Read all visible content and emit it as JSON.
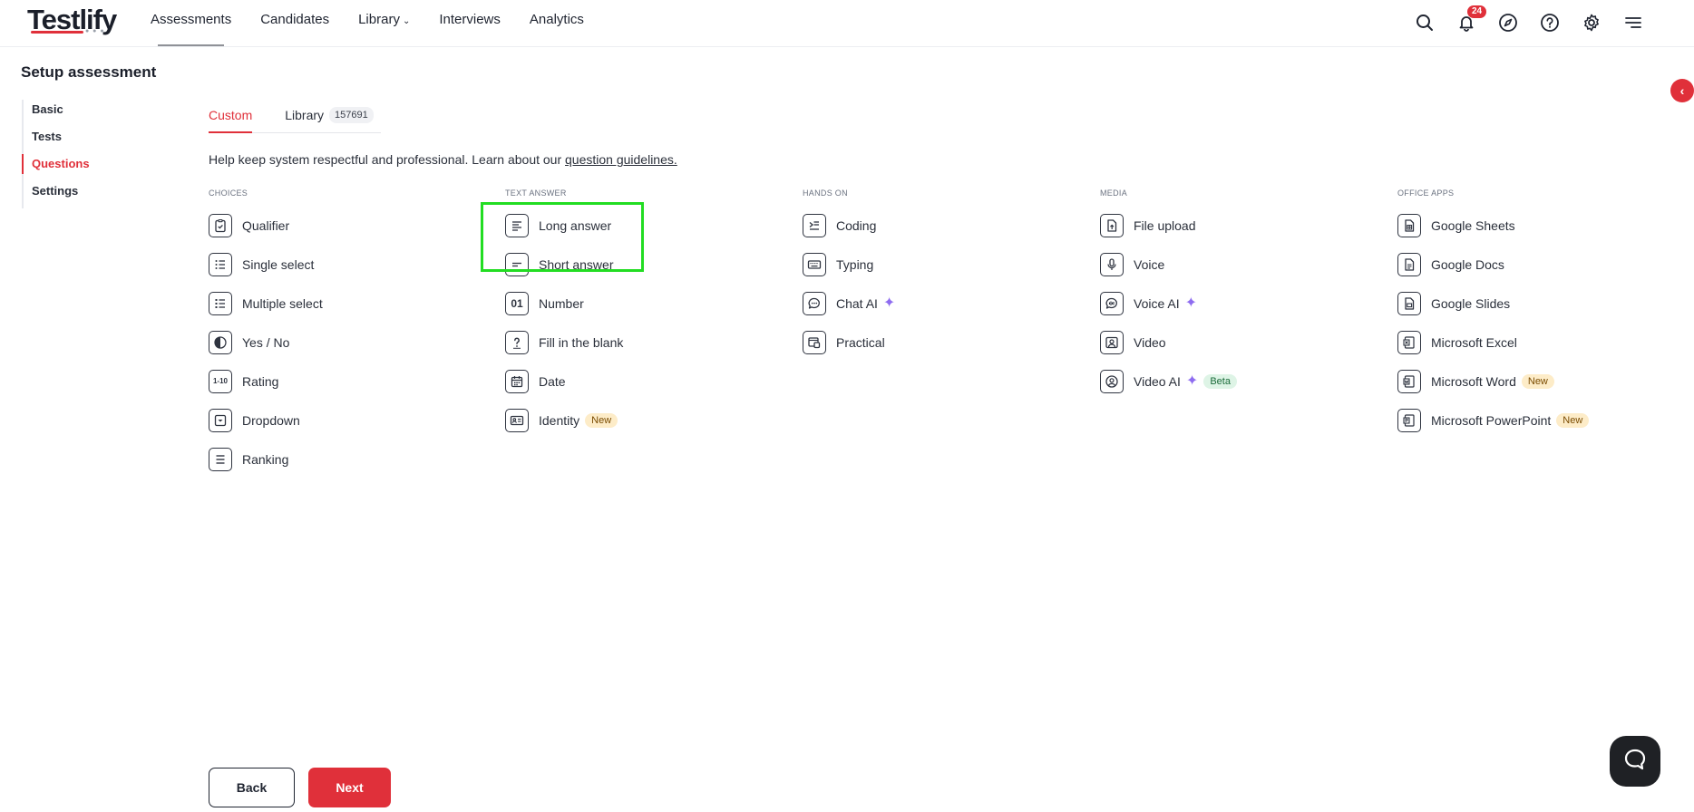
{
  "brand": {
    "logo_text": "Testlify",
    "logo_sub": "● ● ●"
  },
  "nav": {
    "items": [
      {
        "label": "Assessments"
      },
      {
        "label": "Candidates"
      },
      {
        "label": "Library"
      },
      {
        "label": "Interviews"
      },
      {
        "label": "Analytics"
      }
    ],
    "notifications_count": "24",
    "icons": [
      "search-icon",
      "bell-icon",
      "compass-icon",
      "help-icon",
      "gear-icon",
      "menu-icon"
    ]
  },
  "page": {
    "title": "Setup assessment"
  },
  "sidebar": {
    "items": [
      {
        "label": "Basic"
      },
      {
        "label": "Tests"
      },
      {
        "label": "Questions",
        "active": true
      },
      {
        "label": "Settings"
      }
    ]
  },
  "tabs": [
    {
      "label": "Custom",
      "active": true
    },
    {
      "label": "Library",
      "count": "157691"
    }
  ],
  "help": {
    "text": "Help keep system respectful and professional. Learn about our ",
    "link": "question guidelines."
  },
  "columns": [
    {
      "heading": "CHOICES",
      "items": [
        {
          "label": "Qualifier",
          "icon": "clipboard-check-icon"
        },
        {
          "label": "Single select",
          "icon": "list-icon"
        },
        {
          "label": "Multiple select",
          "icon": "list-check-icon"
        },
        {
          "label": "Yes / No",
          "icon": "half-circle-icon"
        },
        {
          "label": "Rating",
          "icon": "rating-scale-icon",
          "glyph": "1-10"
        },
        {
          "label": "Dropdown",
          "icon": "dropdown-icon"
        },
        {
          "label": "Ranking",
          "icon": "ranking-icon"
        }
      ]
    },
    {
      "heading": "TEXT ANSWER",
      "items": [
        {
          "label": "Long answer",
          "icon": "long-text-icon"
        },
        {
          "label": "Short answer",
          "icon": "short-text-icon"
        },
        {
          "label": "Number",
          "icon": "number-icon",
          "glyph": "01"
        },
        {
          "label": "Fill in the blank",
          "icon": "question-mark-icon"
        },
        {
          "label": "Date",
          "icon": "calendar-icon"
        },
        {
          "label": "Identity",
          "icon": "id-card-icon",
          "tag": "New"
        }
      ]
    },
    {
      "heading": "HANDS ON",
      "items": [
        {
          "label": "Coding",
          "icon": "code-icon"
        },
        {
          "label": "Typing",
          "icon": "keyboard-icon"
        },
        {
          "label": "Chat AI",
          "icon": "chat-icon",
          "ai": true
        },
        {
          "label": "Practical",
          "icon": "practical-icon"
        }
      ]
    },
    {
      "heading": "MEDIA",
      "items": [
        {
          "label": "File upload",
          "icon": "file-upload-icon"
        },
        {
          "label": "Voice",
          "icon": "microphone-icon"
        },
        {
          "label": "Voice AI",
          "icon": "voice-ai-icon",
          "ai": true
        },
        {
          "label": "Video",
          "icon": "video-person-icon"
        },
        {
          "label": "Video AI",
          "icon": "video-ai-icon",
          "ai": true,
          "tag": "Beta"
        }
      ]
    },
    {
      "heading": "OFFICE APPS",
      "items": [
        {
          "label": "Google Sheets",
          "icon": "sheets-icon"
        },
        {
          "label": "Google Docs",
          "icon": "docs-icon"
        },
        {
          "label": "Google Slides",
          "icon": "slides-icon"
        },
        {
          "label": "Microsoft Excel",
          "icon": "excel-icon"
        },
        {
          "label": "Microsoft Word",
          "icon": "word-icon",
          "tag": "New"
        },
        {
          "label": "Microsoft PowerPoint",
          "icon": "powerpoint-icon",
          "tag": "New"
        }
      ]
    }
  ],
  "buttons": {
    "back": "Back",
    "next": "Next"
  },
  "colors": {
    "accent": "#e0303a",
    "ai_spark": "#8e6cf0",
    "highlight": "#22dd22"
  }
}
